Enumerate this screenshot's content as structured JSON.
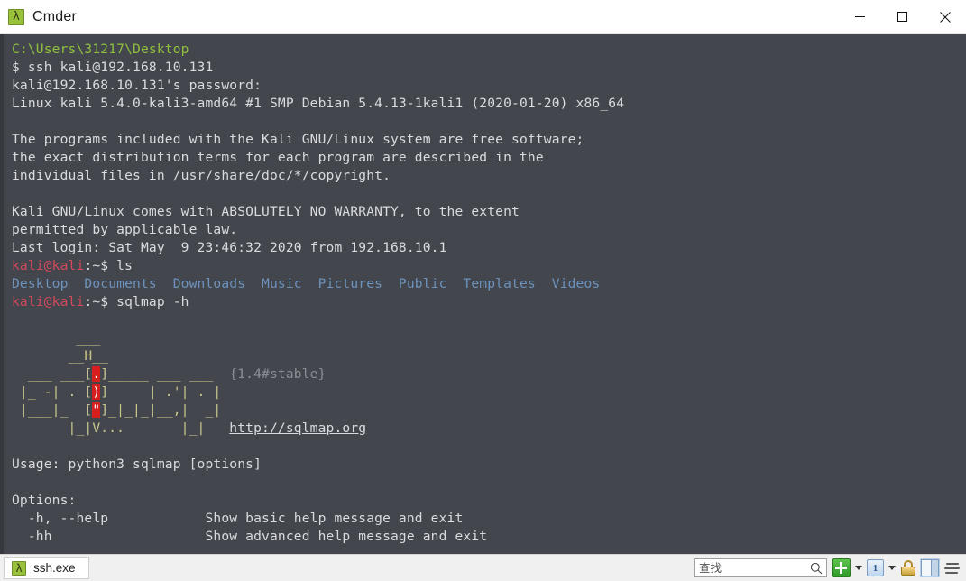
{
  "window": {
    "title": "Cmder",
    "app_icon": "lambda-icon",
    "controls": {
      "minimize": "minimize-button",
      "maximize": "maximize-button",
      "close": "close-button"
    }
  },
  "terminal": {
    "background_color": "#43474d",
    "foreground_color": "#d7d9dc",
    "lines": [
      {
        "segments": [
          {
            "text": "C:\\Users\\31217\\Desktop",
            "color": "c-green"
          }
        ]
      },
      {
        "segments": [
          {
            "text": "$ ssh kali@192.168.10.131",
            "color": "c-white"
          }
        ]
      },
      {
        "segments": [
          {
            "text": "kali@192.168.10.131's password:",
            "color": "c-white"
          }
        ]
      },
      {
        "segments": [
          {
            "text": "Linux kali 5.4.0-kali3-amd64 #1 SMP Debian 5.4.13-1kali1 (2020-01-20) x86_64",
            "color": "c-white"
          }
        ]
      },
      {
        "segments": [
          {
            "text": "",
            "color": "c-white"
          }
        ]
      },
      {
        "segments": [
          {
            "text": "The programs included with the Kali GNU/Linux system are free software;",
            "color": "c-white"
          }
        ]
      },
      {
        "segments": [
          {
            "text": "the exact distribution terms for each program are described in the",
            "color": "c-white"
          }
        ]
      },
      {
        "segments": [
          {
            "text": "individual files in /usr/share/doc/*/copyright.",
            "color": "c-white"
          }
        ]
      },
      {
        "segments": [
          {
            "text": "",
            "color": "c-white"
          }
        ]
      },
      {
        "segments": [
          {
            "text": "Kali GNU/Linux comes with ABSOLUTELY NO WARRANTY, to the extent",
            "color": "c-white"
          }
        ]
      },
      {
        "segments": [
          {
            "text": "permitted by applicable law.",
            "color": "c-white"
          }
        ]
      },
      {
        "segments": [
          {
            "text": "Last login: Sat May  9 23:46:32 2020 from 192.168.10.1",
            "color": "c-white"
          }
        ]
      },
      {
        "segments": [
          {
            "text": "kali@kali",
            "color": "c-red"
          },
          {
            "text": ":~$ ls",
            "color": "c-white"
          }
        ]
      },
      {
        "segments": [
          {
            "text": "Desktop  Documents  Downloads  Music  Pictures  Public  Templates  Videos",
            "color": "c-blue"
          }
        ]
      },
      {
        "segments": [
          {
            "text": "kali@kali",
            "color": "c-red"
          },
          {
            "text": ":~$ sqlmap -h",
            "color": "c-white"
          }
        ]
      },
      {
        "segments": [
          {
            "text": "",
            "color": "c-white"
          }
        ]
      },
      {
        "segments": [
          {
            "text": "        ___",
            "color": "c-art"
          }
        ]
      },
      {
        "segments": [
          {
            "text": "       __H__",
            "color": "c-art"
          }
        ]
      },
      {
        "segments": [
          {
            "text": "  ___ ___[",
            "color": "c-art"
          },
          {
            "text": ".",
            "color": "hl-red"
          },
          {
            "text": "]_____ ___ ___  ",
            "color": "c-art"
          },
          {
            "text": "{1.4#stable}",
            "color": "c-dim"
          }
        ]
      },
      {
        "segments": [
          {
            "text": " |_ -| . [",
            "color": "c-art"
          },
          {
            "text": ")",
            "color": "hl-red"
          },
          {
            "text": "]     | .'| . |",
            "color": "c-art"
          }
        ]
      },
      {
        "segments": [
          {
            "text": " |___|_  [",
            "color": "c-art"
          },
          {
            "text": "\"",
            "color": "hl-red"
          },
          {
            "text": "]_|_|_|__,|  _|",
            "color": "c-art"
          }
        ]
      },
      {
        "segments": [
          {
            "text": "       |_|V...       |_|   ",
            "color": "c-art"
          },
          {
            "text": "http://sqlmap.org",
            "color": "c-white",
            "underline": true
          }
        ]
      },
      {
        "segments": [
          {
            "text": "",
            "color": "c-white"
          }
        ]
      },
      {
        "segments": [
          {
            "text": "Usage: python3 sqlmap [options]",
            "color": "c-white"
          }
        ]
      },
      {
        "segments": [
          {
            "text": "",
            "color": "c-white"
          }
        ]
      },
      {
        "segments": [
          {
            "text": "Options:",
            "color": "c-white"
          }
        ]
      },
      {
        "segments": [
          {
            "text": "  -h, --help            Show basic help message and exit",
            "color": "c-white"
          }
        ]
      },
      {
        "segments": [
          {
            "text": "  -hh                   Show advanced help message and exit",
            "color": "c-white"
          }
        ]
      }
    ]
  },
  "statusbar": {
    "tabs": [
      {
        "label": "ssh.exe",
        "icon": "lambda-icon",
        "active": true
      }
    ],
    "search": {
      "placeholder": "查找",
      "value": "",
      "icon": "magnifier-icon"
    },
    "buttons": [
      {
        "name": "new-console-button",
        "icon": "green-plus-icon"
      },
      {
        "name": "new-console-dropdown",
        "icon": "caret-down-icon"
      },
      {
        "name": "active-console-button",
        "icon": "info-icon",
        "label": "1"
      },
      {
        "name": "active-console-dropdown",
        "icon": "caret-down-icon"
      },
      {
        "name": "elevated-button",
        "icon": "padlock-icon"
      },
      {
        "name": "split-pane-button",
        "icon": "split-pane-icon"
      },
      {
        "name": "main-menu-button",
        "icon": "hamburger-icon"
      }
    ]
  }
}
